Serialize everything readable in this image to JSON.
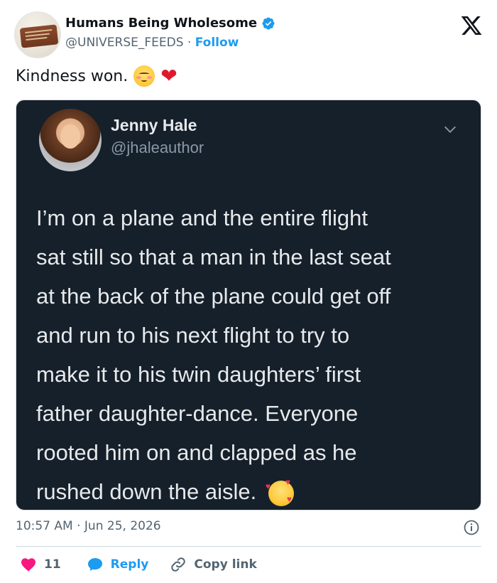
{
  "account": {
    "name": "Humans Being Wholesome",
    "handle": "@UNIVERSE_FEEDS",
    "separator": "·",
    "follow_label": "Follow"
  },
  "post": {
    "text": "Kindness won.",
    "emojis": [
      "smiling-face-with-blush",
      "red-heart"
    ]
  },
  "embedded_tweet": {
    "author_name": "Jenny Hale",
    "author_handle": "@jhaleauthor",
    "lines": [
      "I’m on a plane and the entire flight",
      "sat still so that a man in the last seat",
      "at the back of the plane could get off",
      "and run to his next flight to try to",
      "make it to his twin daughters’ first",
      "father daughter-dance. Everyone",
      "rooted him on and clapped as he",
      "rushed down the aisle."
    ],
    "trailing_emoji": "smiling-face-with-hearts"
  },
  "meta": {
    "time": "10:57 AM",
    "separator": "·",
    "date": "Jun 25, 2026"
  },
  "actions": {
    "like_count": "11",
    "reply_label": "Reply",
    "copy_label": "Copy link"
  },
  "colors": {
    "accent": "#1d9bf0",
    "like": "#f91880",
    "embed_bg": "#15202b",
    "muted": "#536471"
  }
}
